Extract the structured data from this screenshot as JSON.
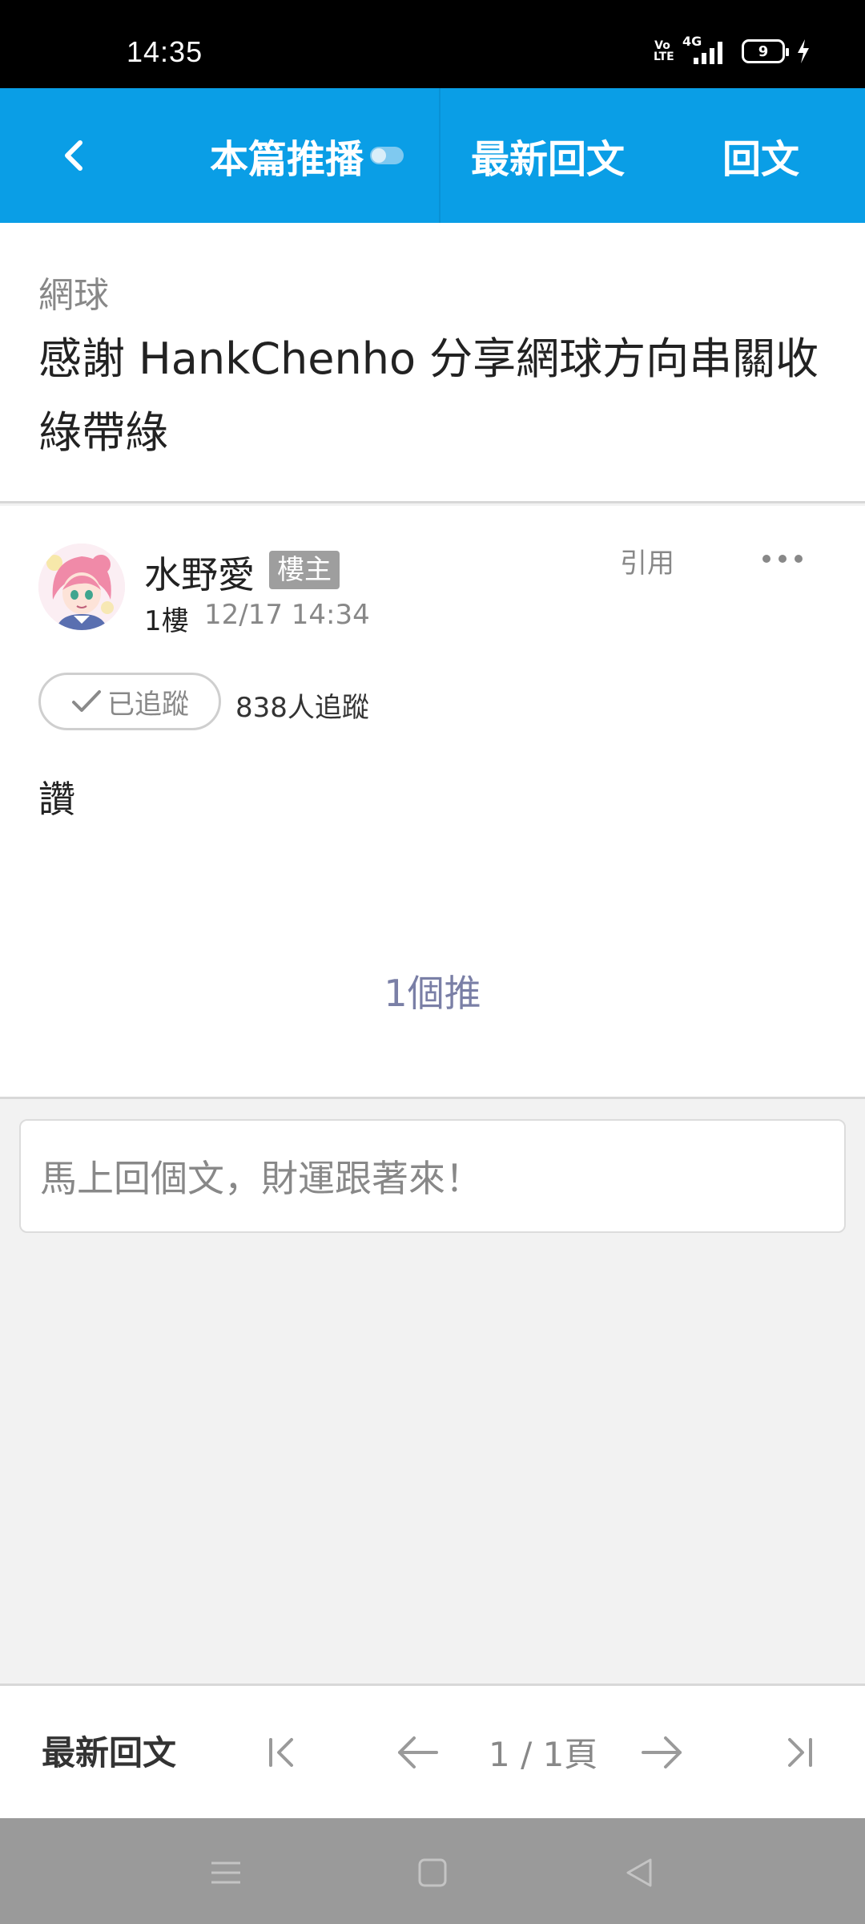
{
  "status_bar": {
    "time": "14:35",
    "volte": "Vo\nLTE",
    "network": "4G",
    "battery_level": "9"
  },
  "header": {
    "back_icon": "chevron-left-icon",
    "push_label": "本篇推播",
    "latest_label": "最新回文",
    "reply_label": "回文",
    "background_color": "#0a9ee6"
  },
  "article": {
    "board": "網球",
    "title": "感謝 HankChenho 分享網球方向串關收綠帶綠"
  },
  "post": {
    "author": "水野愛",
    "badge": "樓主",
    "floor": "1樓",
    "time": "12/17 14:34",
    "quote_label": "引用",
    "follow_label": "已追蹤",
    "follow_count": "838人追蹤",
    "content": "讚",
    "push_count": "1個推"
  },
  "reply_box": {
    "placeholder": "馬上回個文，財運跟著來！"
  },
  "bottom_nav": {
    "latest_label": "最新回文",
    "page_indicator": "1 / 1頁"
  }
}
